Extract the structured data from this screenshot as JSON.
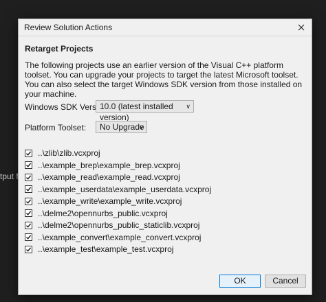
{
  "background": {
    "partial_text": "tput f"
  },
  "dialog": {
    "title": "Review Solution Actions",
    "heading": "Retarget Projects",
    "description": "The following projects use an earlier version of the Visual C++ platform toolset.  You can upgrade your projects to target the latest Microsoft toolset.  You can also select the target Windows SDK version from those installed on your machine.",
    "sdk": {
      "label": "Windows SDK Version:",
      "selected": "10.0 (latest installed version)"
    },
    "toolset": {
      "label": "Platform Toolset:",
      "selected": "No Upgrade"
    },
    "projects": [
      {
        "name": "..\\zlib\\zlib.vcxproj",
        "checked": true
      },
      {
        "name": "..\\example_brep\\example_brep.vcxproj",
        "checked": true
      },
      {
        "name": "..\\example_read\\example_read.vcxproj",
        "checked": true
      },
      {
        "name": "..\\example_userdata\\example_userdata.vcxproj",
        "checked": true
      },
      {
        "name": "..\\example_write\\example_write.vcxproj",
        "checked": true
      },
      {
        "name": "..\\delme2\\opennurbs_public.vcxproj",
        "checked": true
      },
      {
        "name": "..\\delme2\\opennurbs_public_staticlib.vcxproj",
        "checked": true
      },
      {
        "name": "..\\example_convert\\example_convert.vcxproj",
        "checked": true
      },
      {
        "name": "..\\example_test\\example_test.vcxproj",
        "checked": true
      }
    ],
    "ok_label": "OK",
    "cancel_label": "Cancel",
    "icons": {
      "close": "close-icon",
      "dropdown": "chevron-down-icon",
      "check": "checkmark-icon"
    },
    "colors": {
      "dialog_bg": "#f0f0f0",
      "default_button_border": "#0078d7",
      "app_bg": "#1f1f1f"
    }
  }
}
